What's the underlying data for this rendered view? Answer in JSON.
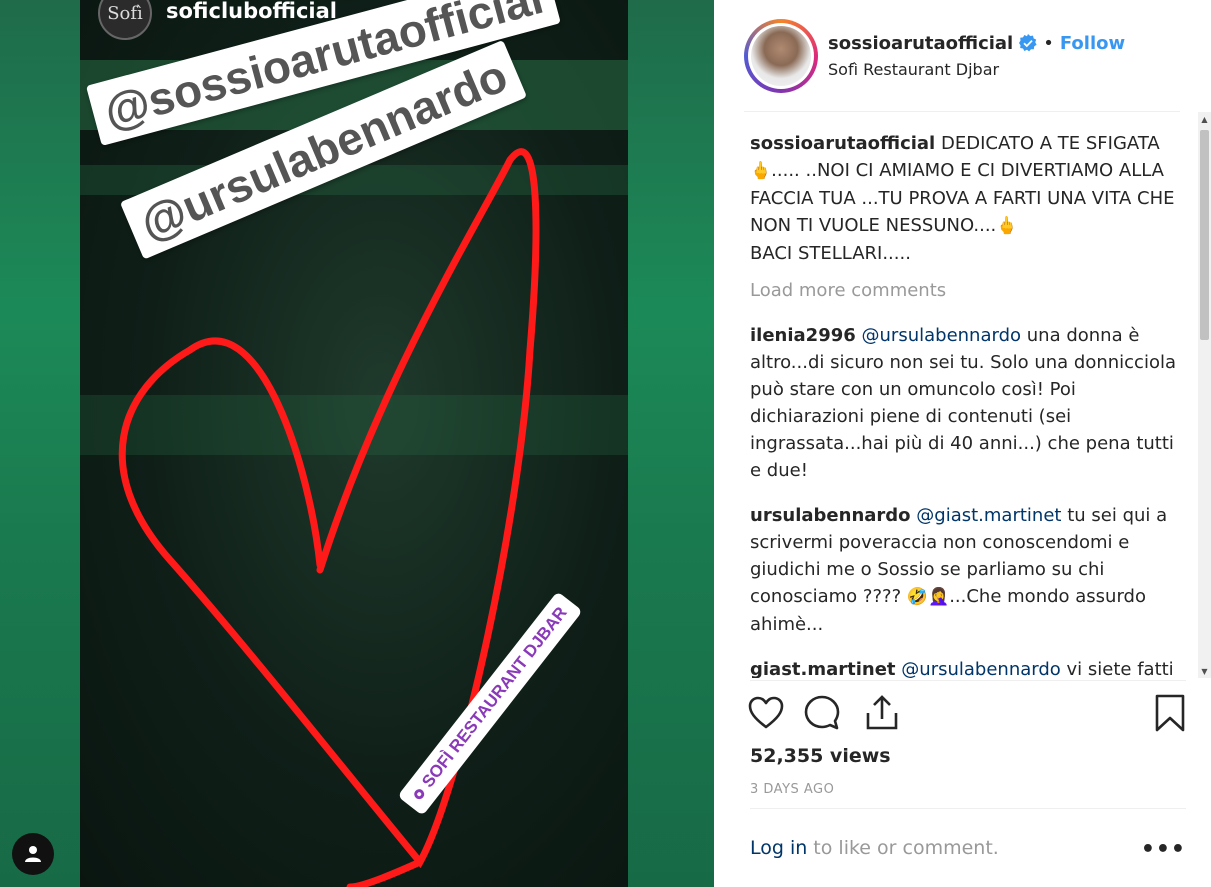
{
  "story": {
    "username": "soficlubofficial",
    "avatar_text": "Sofì",
    "sticker_1": "@sossioarutaofficial",
    "sticker_2": "@ursulabennardo",
    "location_sticker": "SOFÌ RESTAURANT DJBAR"
  },
  "post": {
    "username": "sossioarutaofficial",
    "separator": "•",
    "follow_label": "Follow",
    "location": "Sofì Restaurant Djbar",
    "caption_user": "sossioarutaofficial",
    "caption_text_1": "DEDICATO A TE SFIGATA",
    "caption_text_2": "..... ..NOI CI AMIAMO E CI DIVERTIAMO ALLA FACCIA TUA ...TU PROVA A FARTI UNA VITA CHE NON TI VUOLE NESSUNO....",
    "caption_text_3": "BACI STELLARI.....",
    "load_more": "Load more comments",
    "comments": [
      {
        "user": "ilenia2996",
        "mention": "@ursulabennardo",
        "text": "una donna è altro...di sicuro non sei tu. Solo una donnicciola può stare con un omuncolo così! Poi dichiarazioni piene di contenuti (sei ingrassata...hai più di 40 anni...) che pena tutti e due!"
      },
      {
        "user": "ursulabennardo",
        "mention": "@giast.martinet",
        "text": "tu sei qui a scrivermi poveraccia non conoscendomi e giudichi me o Sossio se parliamo su chi conosciamo ????",
        "text_2": "...Che mondo assurdo ahimè..."
      },
      {
        "user": "giast.martinet",
        "mention": "@ursulabennardo",
        "text": "vi siete fatti fin troppo conoscere Ursula! Fin troppo!"
      }
    ],
    "views": "52,355 views",
    "time_ago": "3 DAYS AGO",
    "login_link": "Log in",
    "login_rest": "to like or comment.",
    "more_label": "•••"
  },
  "icons": {
    "like": "heart-icon",
    "comment": "comment-icon",
    "share": "share-icon",
    "save": "bookmark-icon",
    "verified": "verified-badge-icon",
    "profile": "profile-icon",
    "emoji_middle_finger": "🖕",
    "emoji_laughing": "🤣",
    "emoji_facepalm": "🤦‍♀️"
  },
  "colors": {
    "accent": "#3897f0",
    "mention": "#003569",
    "muted": "#999999",
    "media_green": "#1c8a58",
    "heart_red": "#ff1a1a"
  }
}
